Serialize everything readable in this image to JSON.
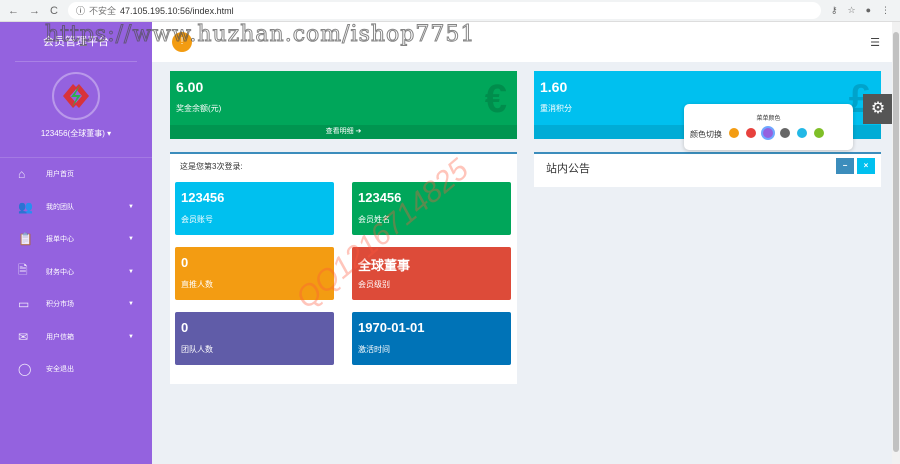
{
  "browser": {
    "security": "不安全",
    "url": "47.105.195.10:56/index.html"
  },
  "sidebar": {
    "title": "会员管理平台",
    "user": "123456(全球董事)",
    "items": [
      {
        "label": "用户首页",
        "icon": "⌂",
        "caret": false
      },
      {
        "label": "我的团队",
        "icon": "👥",
        "caret": true
      },
      {
        "label": "报单中心",
        "icon": "📋",
        "caret": true
      },
      {
        "label": "财务中心",
        "icon": "🗎",
        "caret": true
      },
      {
        "label": "积分市场",
        "icon": "▭",
        "caret": true
      },
      {
        "label": "用户信箱",
        "icon": "✉",
        "caret": true
      },
      {
        "label": "安全退出",
        "icon": "◯",
        "caret": false
      }
    ]
  },
  "stats": {
    "bonus": {
      "value": "6.00",
      "label": "奖金余额(元)",
      "footer": "查看明细"
    },
    "points": {
      "value": "1.60",
      "label": "重消积分"
    }
  },
  "login_box": {
    "title": "这是您第3次登录:",
    "tiles": [
      {
        "value": "123456",
        "label": "会员账号",
        "color": "#00c0ef"
      },
      {
        "value": "123456",
        "label": "会员姓名",
        "color": "#00a65a"
      },
      {
        "value": "0",
        "label": "直推人数",
        "color": "#f39c12"
      },
      {
        "value": "全球董事",
        "label": "会员级别",
        "color": "#dd4b39"
      },
      {
        "value": "0",
        "label": "团队人数",
        "color": "#605ca8"
      },
      {
        "value": "1970-01-01",
        "label": "激活时间",
        "color": "#0073b7"
      }
    ]
  },
  "notice": {
    "title": "站内公告",
    "minimize": "−",
    "close": "×"
  },
  "color_picker": {
    "title": "菜单颜色",
    "label": "颜色切换",
    "colors": [
      "#f39c12",
      "#e7413d",
      "#9462df",
      "#666666",
      "#22b8e6",
      "#7fbf27"
    ]
  },
  "watermarks": [
    "https://www.huzhan.com/ishop7751",
    "QQ1216714825"
  ]
}
